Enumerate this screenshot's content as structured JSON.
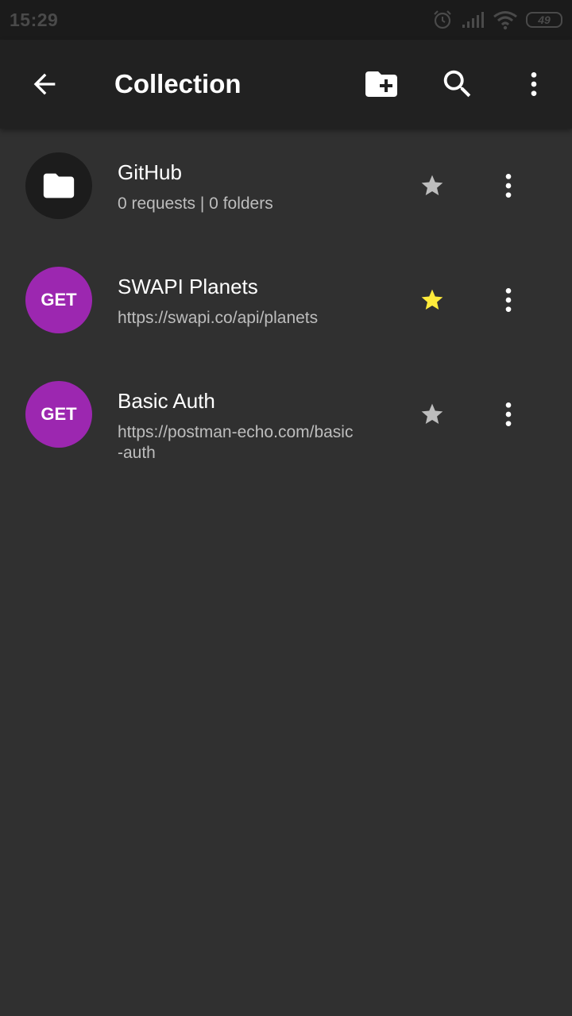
{
  "status_bar": {
    "time": "15:29",
    "battery": "49",
    "icons": [
      "alarm-icon",
      "signal-icon",
      "wifi-icon",
      "battery-icon"
    ]
  },
  "app_bar": {
    "title": "Collection",
    "icons": [
      "back-arrow-icon",
      "create-new-folder-icon",
      "search-icon",
      "more-vert-icon"
    ]
  },
  "colors": {
    "background": "#303030",
    "app_bar": "#212121",
    "status_bar": "#1b1b1b",
    "method_badge": "#9c27b0",
    "star_active": "#ffeb3b",
    "star_inactive": "#bdbdbd"
  },
  "items": [
    {
      "type": "folder",
      "title": "GitHub",
      "subtitle": "0 requests | 0 folders",
      "starred": false
    },
    {
      "type": "request",
      "method": "GET",
      "title": "SWAPI Planets",
      "subtitle": "https://swapi.co/api/planets",
      "starred": true
    },
    {
      "type": "request",
      "method": "GET",
      "title": "Basic Auth",
      "subtitle": "https://postman-echo.com/basic-auth",
      "starred": false
    }
  ]
}
